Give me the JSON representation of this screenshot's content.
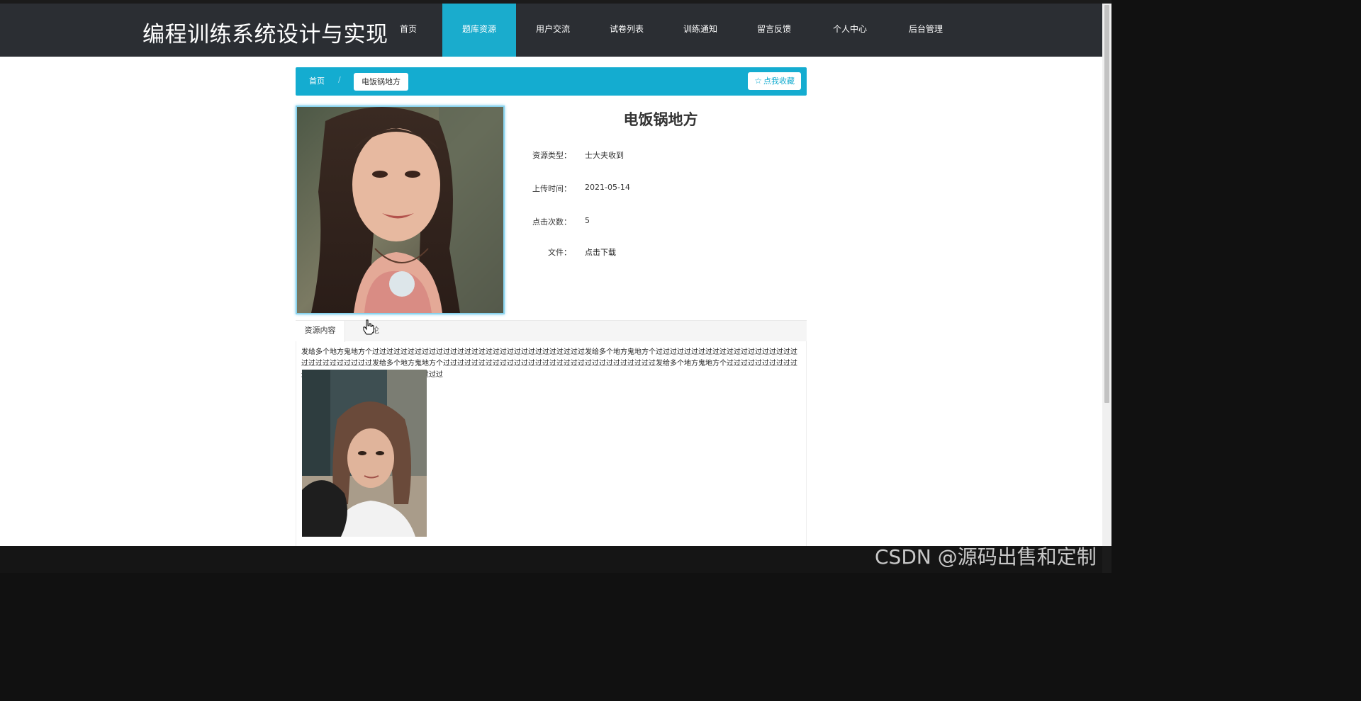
{
  "site": {
    "title": "编程训练系统设计与实现"
  },
  "nav": {
    "items": [
      {
        "label": "首页",
        "active": false
      },
      {
        "label": "题库资源",
        "active": true
      },
      {
        "label": "用户交流",
        "active": false
      },
      {
        "label": "试卷列表",
        "active": false
      },
      {
        "label": "训练通知",
        "active": false
      },
      {
        "label": "留言反馈",
        "active": false
      },
      {
        "label": "个人中心",
        "active": false
      },
      {
        "label": "后台管理",
        "active": false
      }
    ]
  },
  "breadcrumb": {
    "home": "首页",
    "separator": "/",
    "current": "电饭锅地方"
  },
  "favorite": {
    "icon": "star-outline-icon",
    "label": "点我收藏"
  },
  "detail": {
    "title": "电饭锅地方",
    "fields": [
      {
        "label": "资源类型：",
        "value": "士大夫收到"
      },
      {
        "label": "上传时间：",
        "value": "2021-05-14"
      },
      {
        "label": "点击次数：",
        "value": "5"
      },
      {
        "label": "文件：",
        "value": "点击下载"
      }
    ]
  },
  "tabs": {
    "active": "资源内容",
    "second": "评论"
  },
  "content": {
    "text": "发给多个地方鬼地方个过过过过过过过过过过过过过过过过过过过过过过过过过过过过过过发给多个地方鬼地方个过过过过过过过过过过过过过过过过过过过过过过过过过过过过过过发给多个地方鬼地方个过过过过过过过过过过过过过过过过过过过过过过过过过过过过过过发给多个地方鬼地方个过过过过过过过过过过过过过过过过过过过过过过过过过过过过过过"
  },
  "colors": {
    "topbar": "#2b2e33",
    "accent": "#14acd0"
  },
  "watermark": "CSDN @源码出售和定制"
}
